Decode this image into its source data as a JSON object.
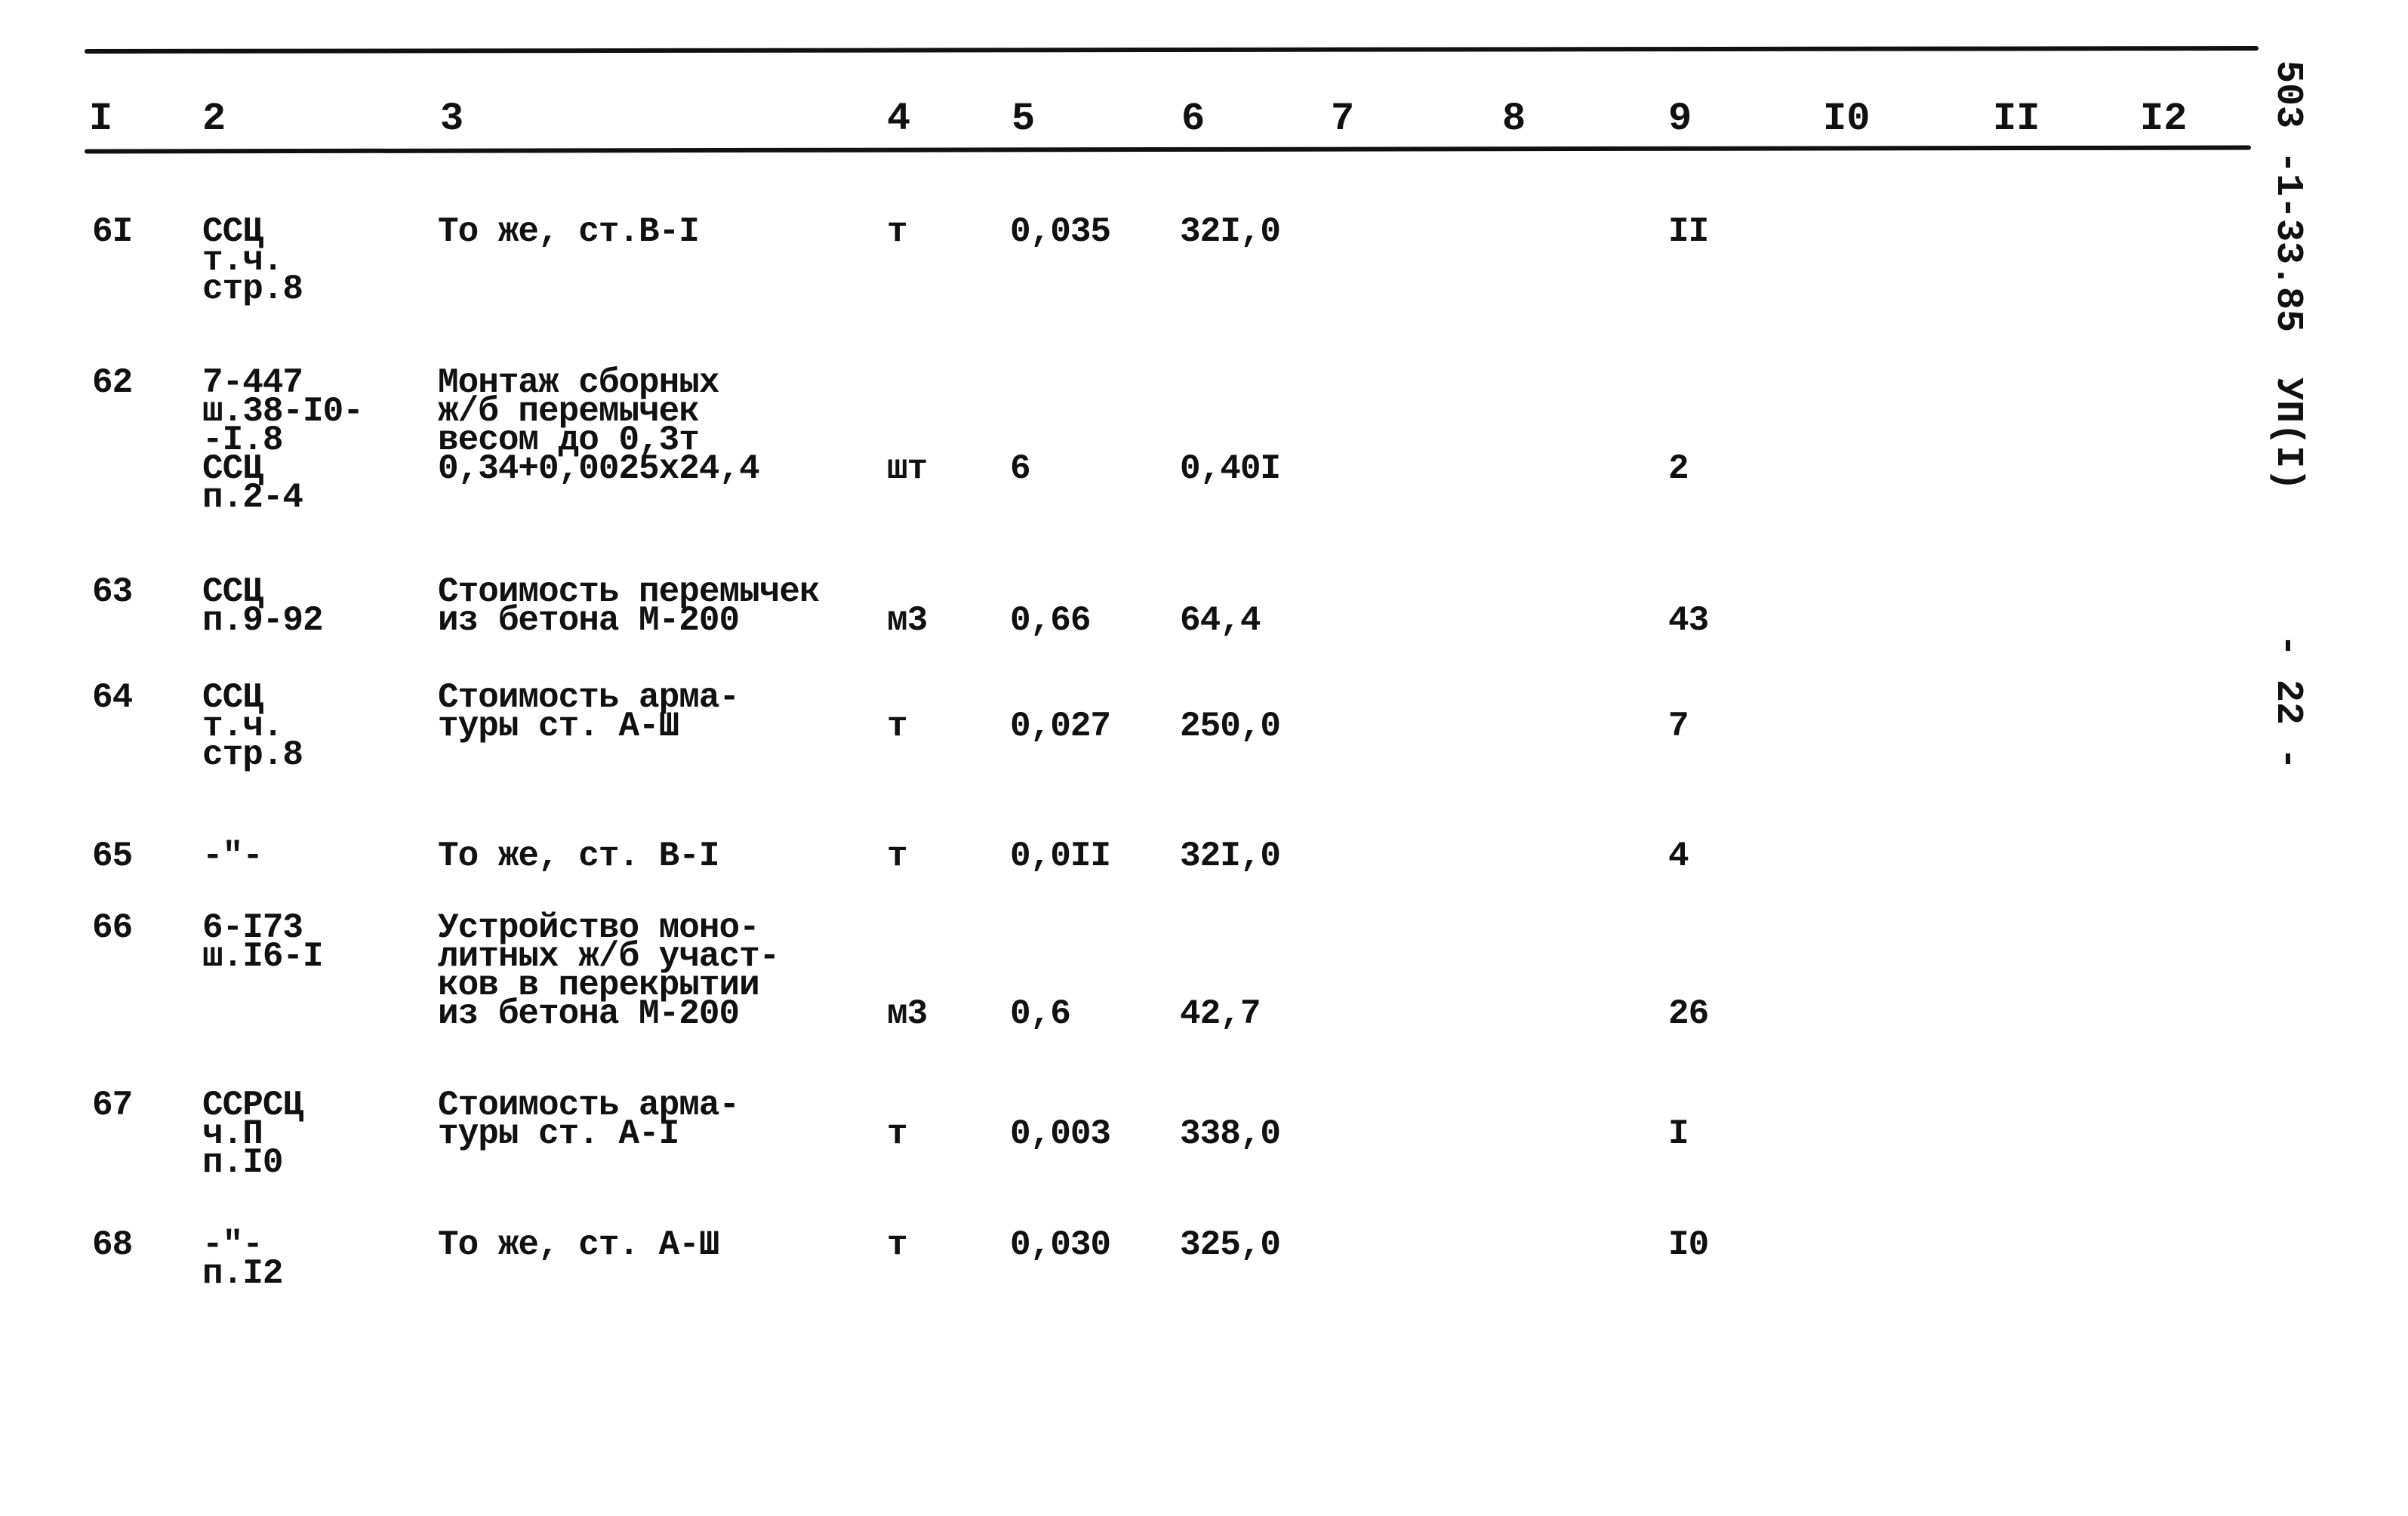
{
  "margin": {
    "document_code": "503 -1-33.85  УП(I)",
    "page_number": "- 22 -"
  },
  "table": {
    "column_headers": [
      "I",
      "2",
      "3",
      "4",
      "5",
      "6",
      "7",
      "8",
      "9",
      "I0",
      "II",
      "I2"
    ],
    "rows": [
      {
        "num": "6I",
        "ref": [
          "ССЦ",
          "т.ч.",
          "стр.8"
        ],
        "desc": [
          "То же, ст.В-I"
        ],
        "unit": "т",
        "qty": "0,035",
        "price": "32I,0",
        "c9": "II"
      },
      {
        "num": "62",
        "ref": [
          "7-447",
          "ш.38-I0-",
          "-I.8",
          "ССЦ",
          "п.2-4"
        ],
        "desc": [
          "Монтаж сборных",
          "ж/б перемычек",
          "весом до 0,3т",
          "0,34+0,0025х24,4"
        ],
        "unit": "шт",
        "qty": "6",
        "price": "0,40I",
        "c9": "2"
      },
      {
        "num": "63",
        "ref": [
          "ССЦ",
          "п.9-92"
        ],
        "desc": [
          "Стоимость перемычек",
          "из бетона М-200"
        ],
        "unit": "м3",
        "qty": "0,66",
        "price": "64,4",
        "c9": "43"
      },
      {
        "num": "64",
        "ref": [
          "ССЦ",
          "т.ч.",
          "стр.8"
        ],
        "desc": [
          "Стоимость арма-",
          "туры ст. А-Ш"
        ],
        "unit": "т",
        "qty": "0,027",
        "price": "250,0",
        "c9": "7"
      },
      {
        "num": "65",
        "ref": [
          "-\"-"
        ],
        "desc": [
          "То же, ст. В-I"
        ],
        "unit": "т",
        "qty": "0,0II",
        "price": "32I,0",
        "c9": "4"
      },
      {
        "num": "66",
        "ref": [
          "6-I73",
          "ш.I6-I"
        ],
        "desc": [
          "Устройство моно-",
          "литных ж/б участ-",
          "ков в перекрытии",
          "из бетона М-200"
        ],
        "unit": "м3",
        "qty": "0,6",
        "price": "42,7",
        "c9": "26"
      },
      {
        "num": "67",
        "ref": [
          "ССРСЦ",
          "ч.П",
          "п.I0"
        ],
        "desc": [
          "Стоимость арма-",
          "туры ст. А-I"
        ],
        "unit": "т",
        "qty": "0,003",
        "price": "338,0",
        "c9": "I"
      },
      {
        "num": "68",
        "ref": [
          "-\"-",
          "п.I2"
        ],
        "desc": [
          "То же, ст. А-Ш"
        ],
        "unit": "т",
        "qty": "0,030",
        "price": "325,0",
        "c9": "I0"
      }
    ]
  }
}
